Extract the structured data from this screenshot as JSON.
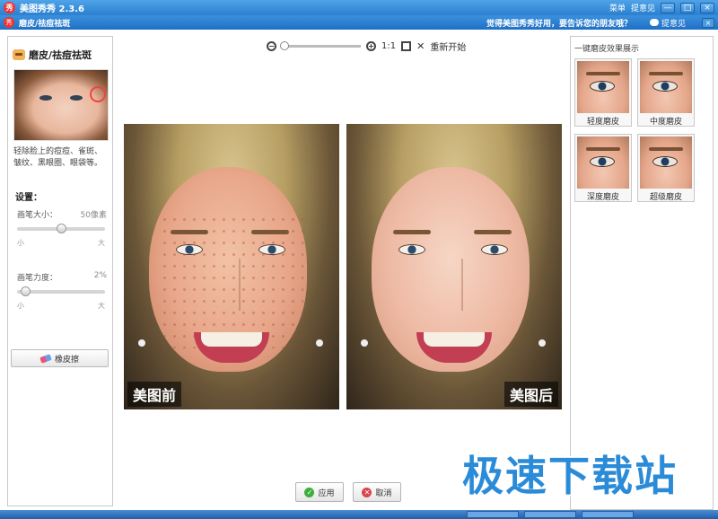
{
  "window": {
    "app_title": "美图秀秀 2.3.6",
    "menu_label": "菜单",
    "feedback_label": "提意见",
    "min_label": "—",
    "max_label": "□",
    "close_label": "×"
  },
  "subbar": {
    "title": "磨皮/祛痘祛斑",
    "slogan": "觉得美图秀秀好用，要告诉您的朋友哦？",
    "feedback_label": "提意见",
    "close_label": "×"
  },
  "left_panel": {
    "title": "磨皮/祛痘祛斑",
    "description": "轻除脸上的痘痘、雀斑、皱纹、黑眼圈、眼袋等。",
    "settings_label": "设置：",
    "brush_size_label": "画笔大小：",
    "brush_size_value": "50像素",
    "brush_size_fraction": 0.5,
    "brush_strength_label": "画笔力度：",
    "brush_strength_value": "2%",
    "brush_strength_fraction": 0.05,
    "scale_min": "小",
    "scale_max": "大",
    "eraser_label": "橡皮擦"
  },
  "toolbar": {
    "zoom_out": "−",
    "zoom_in": "+",
    "one_to_one": "1:1",
    "reset_label": "重新开始"
  },
  "photos": {
    "before_label": "美图前",
    "after_label": "美图后"
  },
  "buttons": {
    "apply_label": "应用",
    "cancel_label": "取消"
  },
  "right_panel": {
    "title": "一键磨皮效果展示",
    "presets": [
      {
        "label": "轻度磨皮"
      },
      {
        "label": "中度磨皮"
      },
      {
        "label": "深度磨皮"
      },
      {
        "label": "超级磨皮"
      }
    ]
  },
  "watermark": {
    "text": "极速下载站"
  },
  "colors": {
    "titlebar": "#2a7fcf",
    "watermark": "#2a8bd8",
    "apply_icon": "#3cae3c",
    "cancel_icon": "#d9454f"
  }
}
